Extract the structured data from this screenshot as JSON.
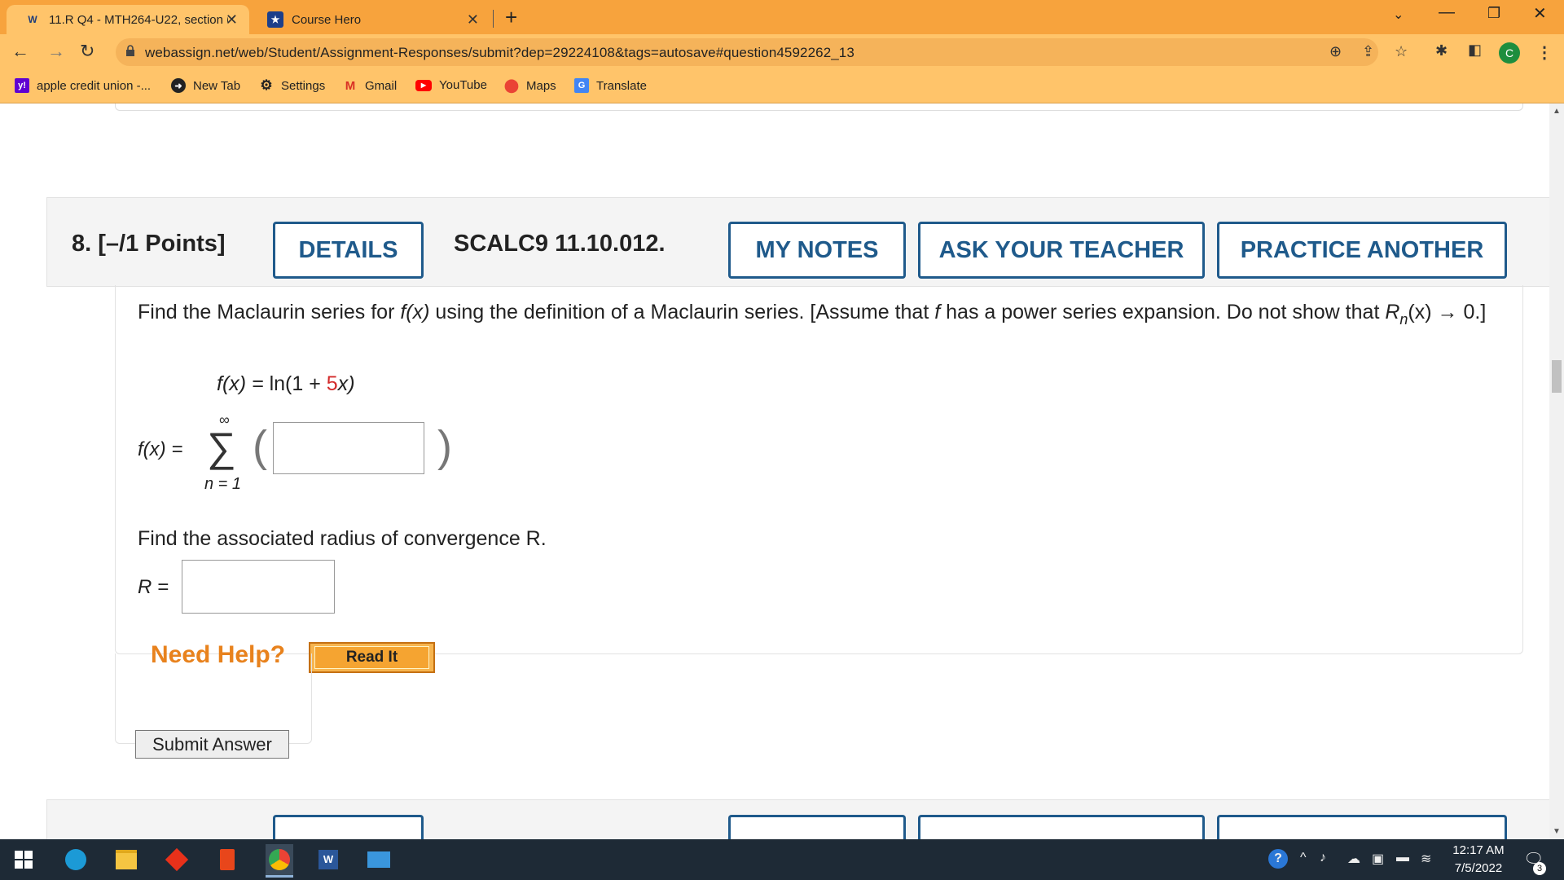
{
  "browser": {
    "tabs": [
      {
        "title": "11.R Q4 - MTH264-U22, section (",
        "icon": "webassign-icon"
      },
      {
        "title": "Course Hero",
        "icon": "course-hero-icon"
      }
    ],
    "url": "webassign.net/web/Student/Assignment-Responses/submit?dep=29224108&tags=autosave#question4592262_13",
    "profile_initial": "C",
    "bookmarks": [
      {
        "label": "apple credit union -...",
        "icon": "yahoo-icon"
      },
      {
        "label": "New Tab",
        "icon": "globe-icon"
      },
      {
        "label": "Settings",
        "icon": "gear-icon"
      },
      {
        "label": "Gmail",
        "icon": "gmail-icon"
      },
      {
        "label": "YouTube",
        "icon": "youtube-icon"
      },
      {
        "label": "Maps",
        "icon": "maps-icon"
      },
      {
        "label": "Translate",
        "icon": "translate-icon"
      }
    ]
  },
  "question": {
    "title": "8.  [–/1 Points]",
    "details_label": "DETAILS",
    "code": "SCALC9 11.10.012.",
    "notes_label": "MY NOTES",
    "ask_label": "ASK YOUR TEACHER",
    "practice_label": "PRACTICE ANOTHER",
    "prompt_a": "Find the Maclaurin series for ",
    "prompt_fx": "f(x)",
    "prompt_b": " using the definition of a Maclaurin series. [Assume that ",
    "prompt_f": "f",
    "prompt_c": " has a power series expansion. Do not show that ",
    "prompt_R": "R",
    "prompt_n": "n",
    "prompt_d": "(x) → 0.]",
    "function_lhs": "f(x) = ",
    "function_rhs_a": "ln(1 + ",
    "function_coef": "5",
    "function_rhs_b": "x)",
    "series_lhs": "f(x) = ",
    "series_sigma": "∑",
    "series_upper": "∞",
    "series_lower": "n = 1",
    "radius_prompt": "Find the associated radius of convergence R.",
    "radius_lhs": "R = ",
    "need_help": "Need Help?",
    "read_it": "Read It",
    "submit_label": "Submit Answer"
  },
  "taskbar": {
    "time": "12:17 AM",
    "date": "7/5/2022",
    "notification_count": "3"
  }
}
